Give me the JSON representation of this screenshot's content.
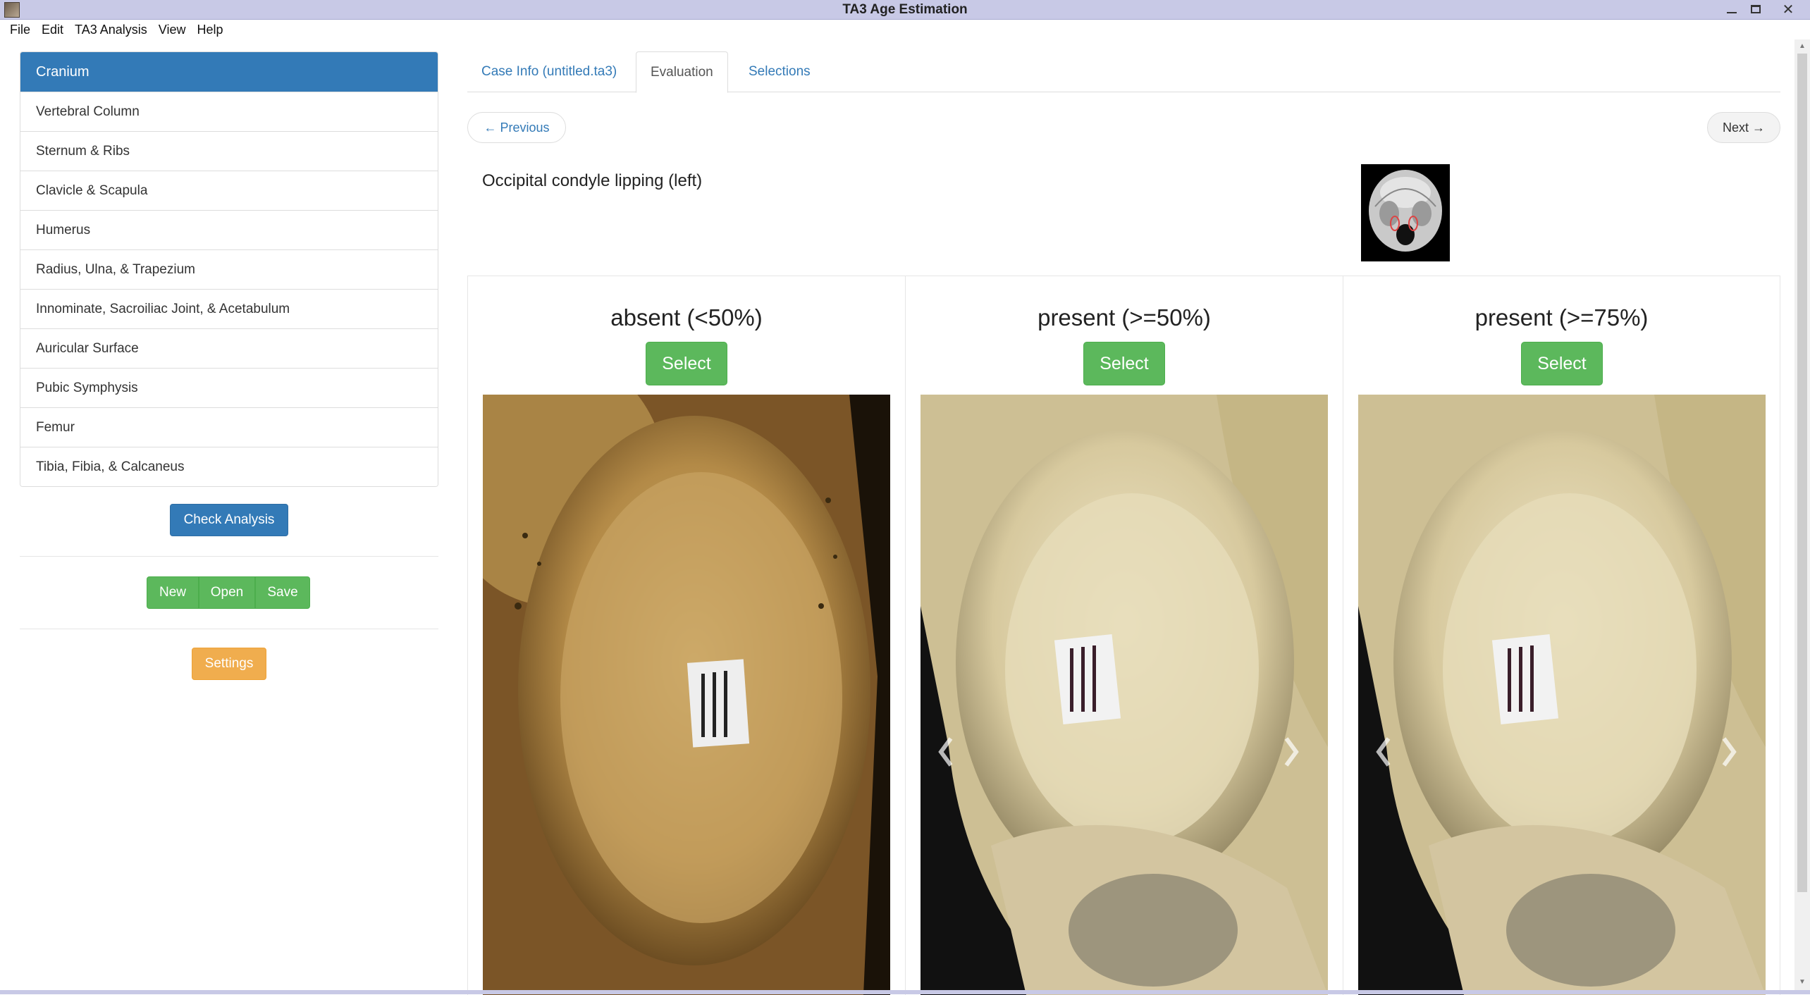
{
  "window": {
    "title": "TA3 Age Estimation"
  },
  "menu": [
    "File",
    "Edit",
    "TA3 Analysis",
    "View",
    "Help"
  ],
  "sidebar": {
    "items": [
      {
        "label": "Cranium",
        "active": true
      },
      {
        "label": "Vertebral Column"
      },
      {
        "label": "Sternum & Ribs"
      },
      {
        "label": "Clavicle & Scapula"
      },
      {
        "label": "Humerus"
      },
      {
        "label": "Radius, Ulna, & Trapezium"
      },
      {
        "label": "Innominate, Sacroiliac Joint, & Acetabulum"
      },
      {
        "label": "Auricular Surface"
      },
      {
        "label": "Pubic Symphysis"
      },
      {
        "label": "Femur"
      },
      {
        "label": "Tibia, Fibia, & Calcaneus"
      }
    ],
    "check_analysis": "Check Analysis",
    "file_buttons": {
      "new": "New",
      "open": "Open",
      "save": "Save"
    },
    "settings": "Settings"
  },
  "tabs": [
    {
      "label": "Case Info (untitled.ta3)"
    },
    {
      "label": "Evaluation",
      "active": true
    },
    {
      "label": "Selections"
    }
  ],
  "pager": {
    "previous": "← Previous",
    "next": "Next →"
  },
  "feature": {
    "title": "Occipital condyle lipping (left)",
    "thumbnail_icon": "skull-base-diagram"
  },
  "panels": [
    {
      "heading": "absent (<50%)",
      "select_label": "Select",
      "photo": "bone-photo-absent",
      "arrows": false
    },
    {
      "heading": "present (>=50%)",
      "select_label": "Select",
      "photo": "bone-photo-present-50",
      "arrows": true
    },
    {
      "heading": "present (>=75%)",
      "select_label": "Select",
      "photo": "bone-photo-present-75",
      "arrows": true
    }
  ],
  "colors": {
    "primary": "#337ab7",
    "success": "#5cb85c",
    "warning": "#f0ad4e",
    "titlebar": "#c8c9e6"
  }
}
